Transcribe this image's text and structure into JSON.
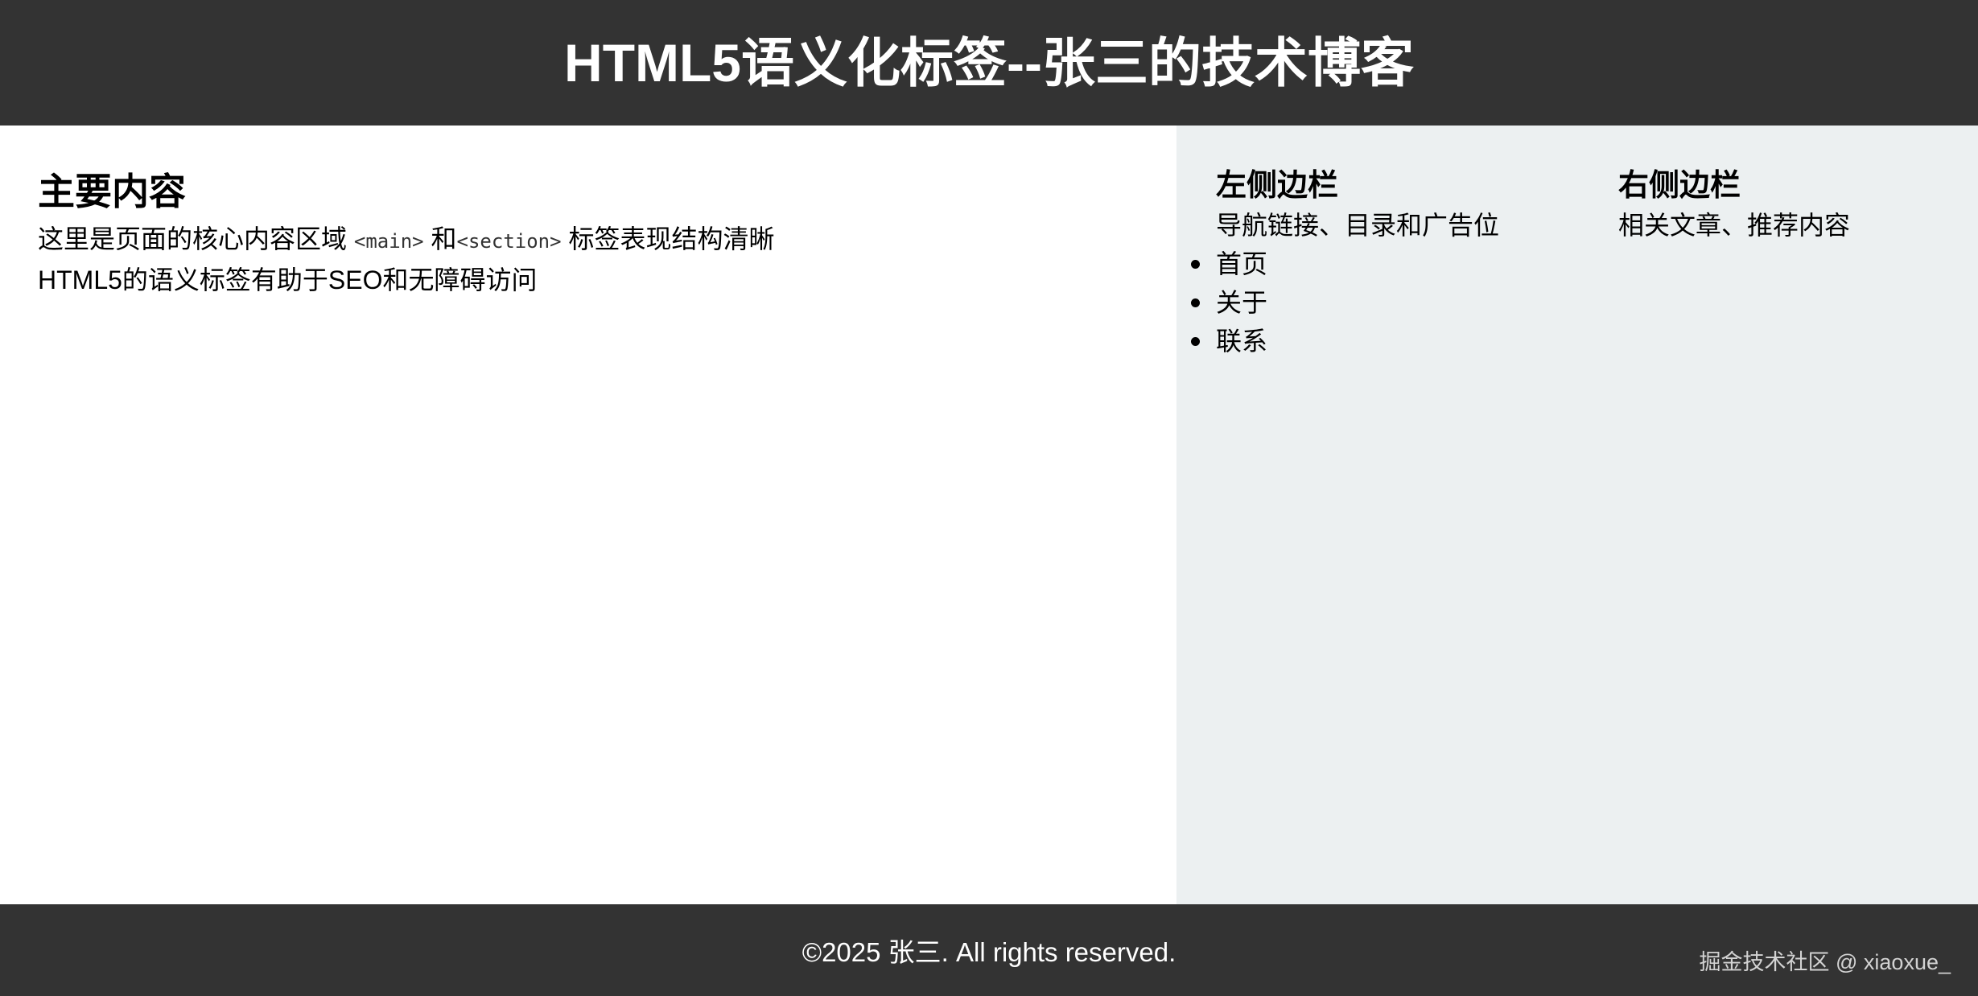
{
  "header": {
    "title": "HTML5语义化标签--张三的技术博客"
  },
  "main": {
    "heading": "主要内容",
    "line1_prefix": "这里是页面的核心内容区域 ",
    "code_main": "<main>",
    "line1_middle": " 和",
    "code_section": "<section>",
    "line1_suffix": " 标签表现结构清晰",
    "line2": "HTML5的语义标签有助于SEO和无障碍访问"
  },
  "left_sidebar": {
    "heading": "左侧边栏",
    "description": "导航链接、目录和广告位",
    "nav_items": [
      "首页",
      "关于",
      "联系"
    ]
  },
  "right_sidebar": {
    "heading": "右侧边栏",
    "description": "相关文章、推荐内容"
  },
  "footer": {
    "copyright": "©2025 张三. All rights reserved.",
    "watermark": "掘金技术社区 @ xiaoxue_"
  },
  "colors": {
    "header_bg": "#333333",
    "footer_bg": "#333333",
    "aside_bg": "#ecf0f1",
    "header_text": "#ffffff"
  }
}
